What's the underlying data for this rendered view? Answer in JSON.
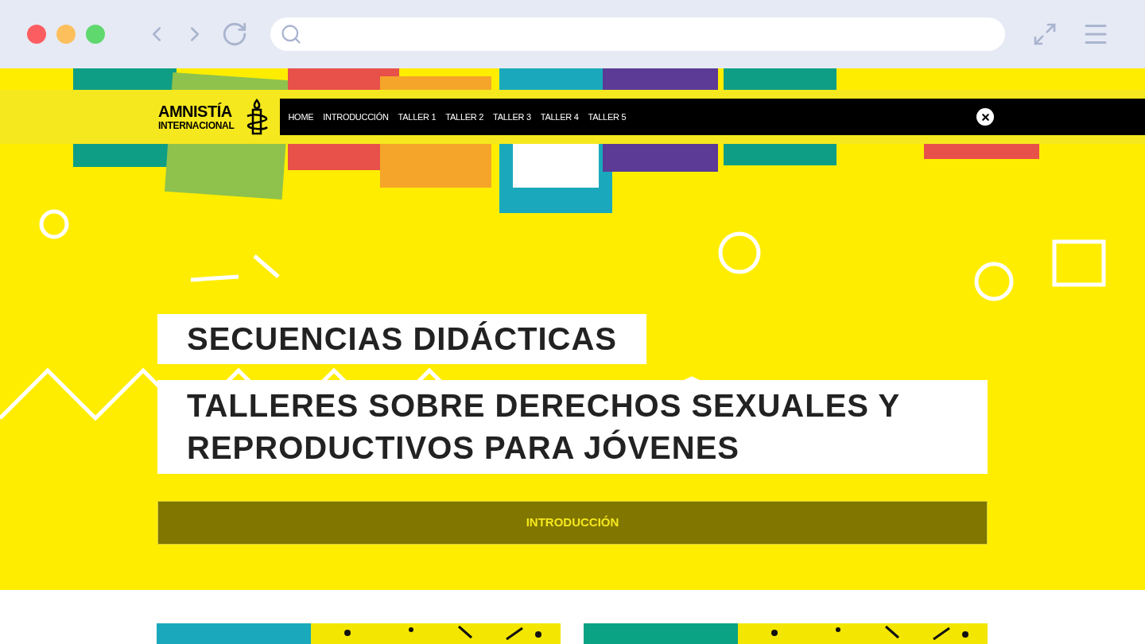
{
  "logo": {
    "lines": [
      "AMNISTÍA",
      "INTERNACIONAL"
    ]
  },
  "nav": {
    "items": [
      {
        "label": "HOME"
      },
      {
        "label": "INTRODUCCIÓN"
      },
      {
        "label": "TALLER 1"
      },
      {
        "label": "TALLER 2"
      },
      {
        "label": "TALLER 3"
      },
      {
        "label": "TALLER 4"
      },
      {
        "label": "TALLER 5"
      }
    ]
  },
  "hero": {
    "kicker": "SECUENCIAS DIDÁCTICAS",
    "title": "TALLERES SOBRE DERECHOS SEXUALES Y REPRODUCTIVOS PARA JÓVENES",
    "button": "INTRODUCCIÓN"
  }
}
